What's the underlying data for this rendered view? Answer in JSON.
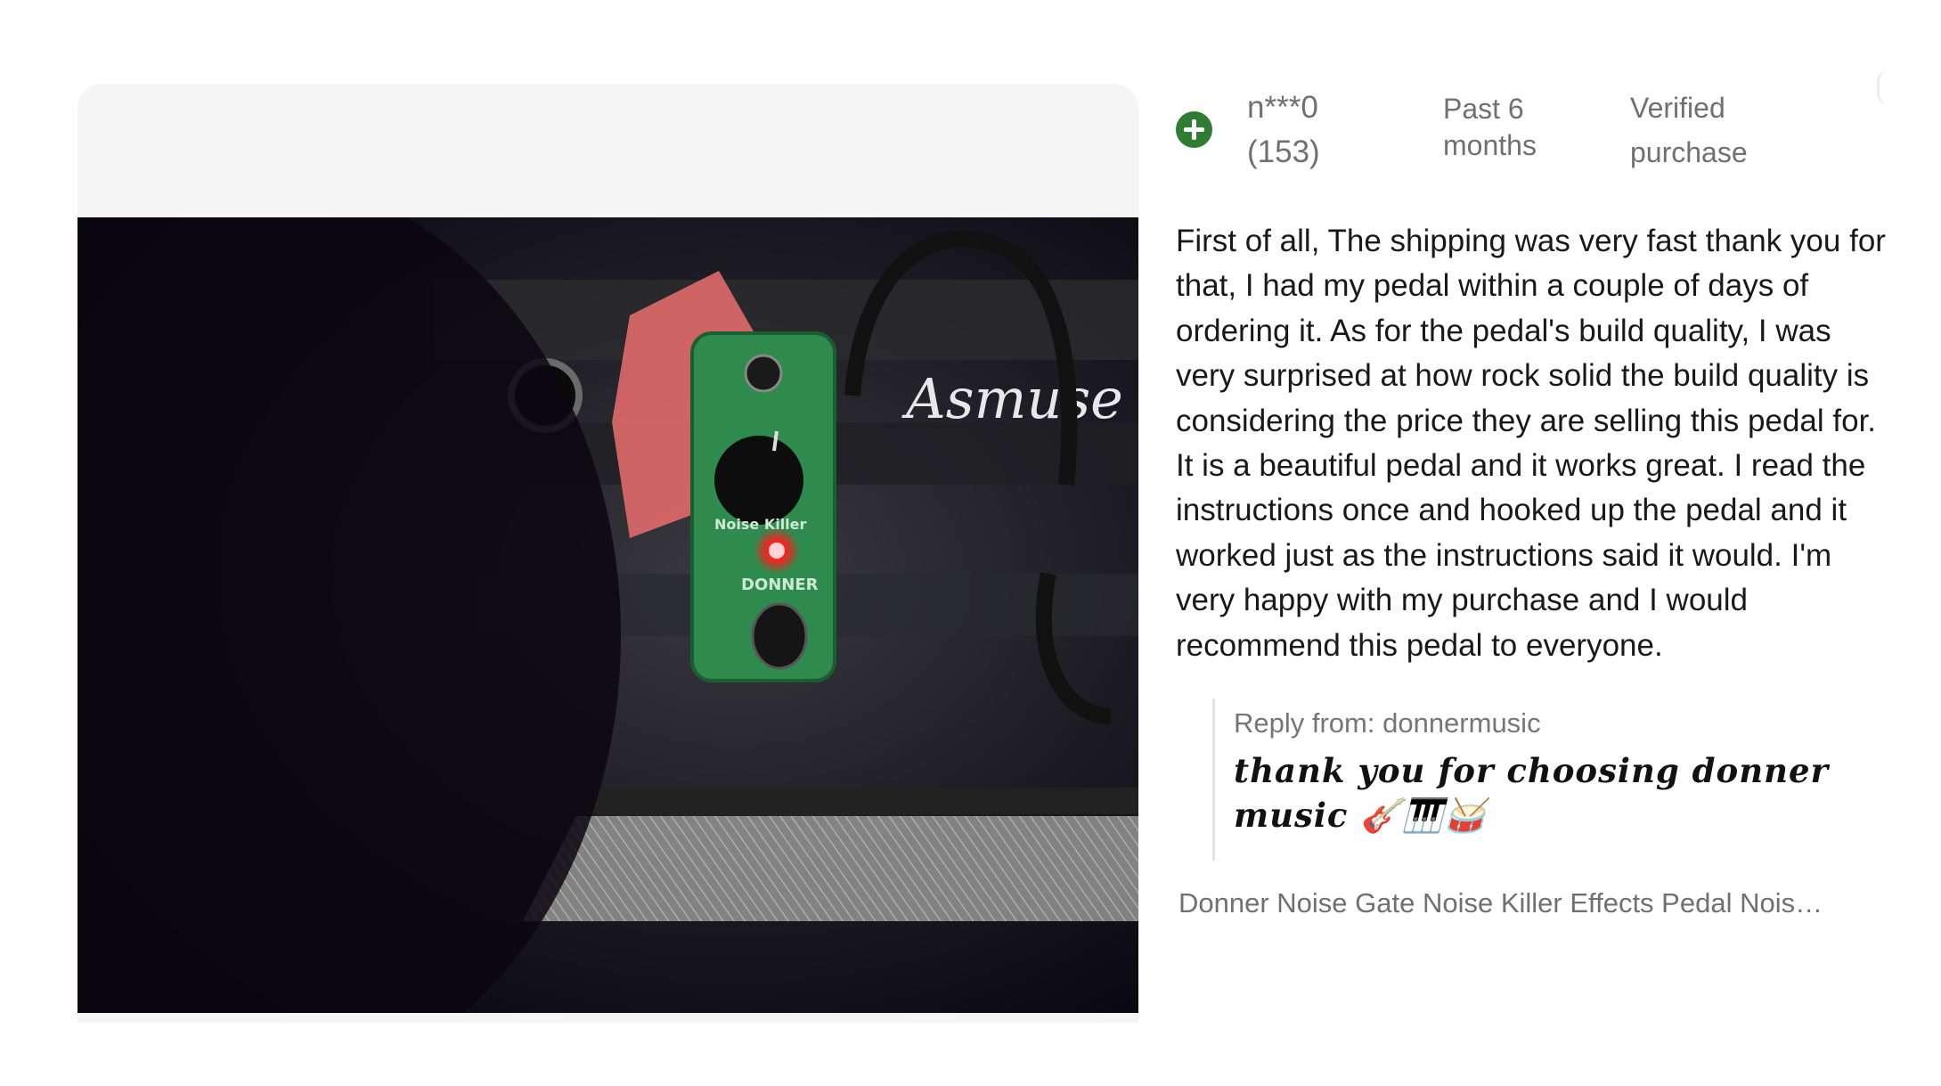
{
  "review": {
    "avatar_icon": "plus-circle-icon",
    "reviewer_name": "n***0",
    "reviewer_count": "(153)",
    "time_line1": "Past 6",
    "time_line2": "months",
    "verified_line1": "Verified",
    "verified_line2": "purchase",
    "body": "First of all, The shipping was very fast thank you for that, I had my pedal within a couple of days of ordering it. As for the pedal's build quality, I was very surprised at how rock solid the build quality is considering the price they are selling this pedal for. It is a beautiful pedal and it works great. I read the instructions once and hooked up the pedal and it worked just as the instructions said it would. I'm very happy with my purchase and I would recommend this pedal to everyone.",
    "reply_label": "Reply from: donnermusic",
    "reply_text_line1": "thank you for choosing donner",
    "reply_text_line2": "music 🎸🎹🥁",
    "product_title": "Donner Noise Gate Noise Killer Effects Pedal Noise…"
  },
  "photo": {
    "amp_script": "Asmuse",
    "pedal_brand": "DONNER",
    "pedal_name": "Noise Killer",
    "colors": {
      "pedal": "#2f8a4d",
      "led": "#ff2a2a",
      "accent_green": "#2e7d32"
    }
  }
}
